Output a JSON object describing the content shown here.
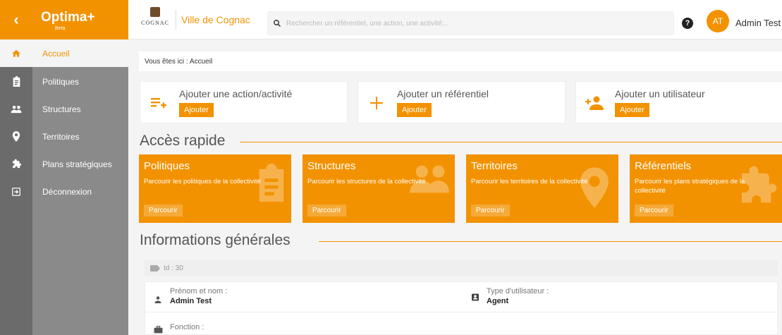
{
  "brand": {
    "name": "Optima+",
    "sub": "Beta"
  },
  "header": {
    "logo_text": "COGNAC",
    "city": "Ville de Cognac",
    "search_placeholder": "Rechercher un référentiel, une action, une activité...",
    "help": "?",
    "avatar_initials": "AT",
    "user_name": "Admin Test"
  },
  "sidebar": {
    "items": [
      {
        "label": "Accueil",
        "icon": "home-icon"
      },
      {
        "label": "Politiques",
        "icon": "clipboard-icon"
      },
      {
        "label": "Structures",
        "icon": "people-icon"
      },
      {
        "label": "Territoires",
        "icon": "location-pin-icon"
      },
      {
        "label": "Plans stratégiques",
        "icon": "puzzle-icon"
      },
      {
        "label": "Déconnexion",
        "icon": "logout-icon"
      }
    ]
  },
  "breadcrumb": "Vous êtes ici : Accueil",
  "quick_add": [
    {
      "title": "Ajouter une action/activité",
      "button": "Ajouter",
      "icon": "add-list-icon"
    },
    {
      "title": "Ajouter un référentiel",
      "button": "Ajouter",
      "icon": "plus-icon"
    },
    {
      "title": "Ajouter un utilisateur",
      "button": "Ajouter",
      "icon": "add-user-icon"
    }
  ],
  "quick_access": {
    "title": "Accès rapide",
    "cards": [
      {
        "title": "Politiques",
        "desc": "Parcourir les politiques de la collectivité",
        "button": "Parcourir",
        "icon": "clipboard-icon"
      },
      {
        "title": "Structures",
        "desc": "Parcourir les structures de la collectivité",
        "button": "Parcourir",
        "icon": "people-icon"
      },
      {
        "title": "Territoires",
        "desc": "Parcourir les territoires de la collectivité",
        "button": "Parcourir",
        "icon": "location-pin-icon"
      },
      {
        "title": "Référentiels",
        "desc": "Parcourir les plans stratégiques de la collectivité",
        "button": "Parcourir",
        "icon": "puzzle-icon"
      }
    ]
  },
  "general_info": {
    "title": "Informations générales",
    "id_text": "Id : 30",
    "name_label": "Prénom et nom :",
    "name_value": "Admin Test",
    "type_label": "Type d'utilisateur :",
    "type_value": "Agent",
    "function_label": "Fonction :"
  },
  "colors": {
    "accent": "#f39200",
    "sidebar_rail": "#6b6b6b",
    "sidebar_nav": "#8a8a8a"
  }
}
